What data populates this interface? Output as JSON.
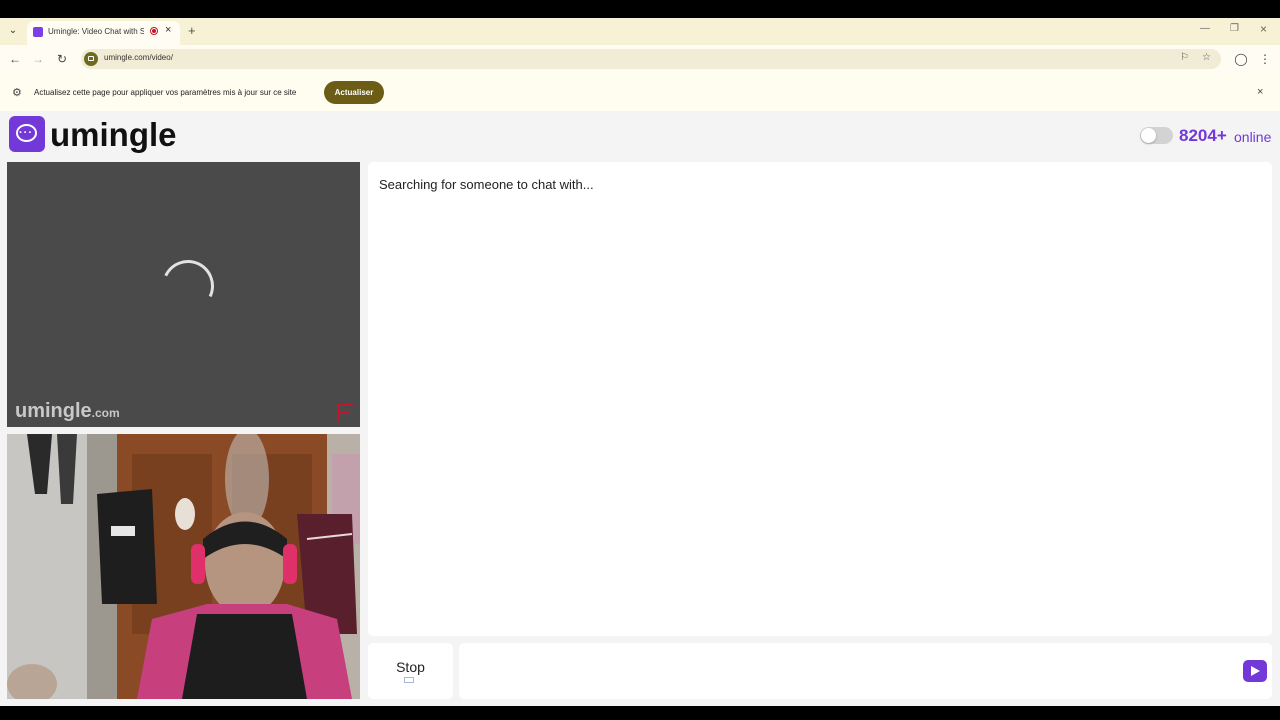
{
  "browser": {
    "tab_title": "Umingle: Video Chat with S",
    "url": "umingle.com/video/",
    "infobar_text": "Actualisez cette page pour appliquer vos paramètres mis à jour sur ce site",
    "infobar_button": "Actualiser",
    "icons": [
      "tab-search-icon",
      "favicon-icon",
      "recording-icon",
      "close-icon",
      "plus-icon",
      "minimize-icon",
      "restore-icon",
      "back-icon",
      "forward-icon",
      "reload-icon",
      "site-info-icon",
      "translate-icon",
      "star-icon",
      "profile-icon",
      "menu-icon",
      "settings-icon"
    ]
  },
  "header": {
    "logo_text": "umingle",
    "online_count": "8204+",
    "online_label": "online",
    "toggle_state": "off"
  },
  "remote_video": {
    "watermark_main": "umingle",
    "watermark_suffix": ".com",
    "loading": true
  },
  "chat": {
    "status_text": "Searching for someone to chat with...",
    "stop_label": "Stop",
    "message_value": "",
    "send_icon": "send-icon"
  },
  "colors": {
    "brand": "#7338d8",
    "infobar_button": "#6b5d15",
    "recording": "#c0172c"
  }
}
